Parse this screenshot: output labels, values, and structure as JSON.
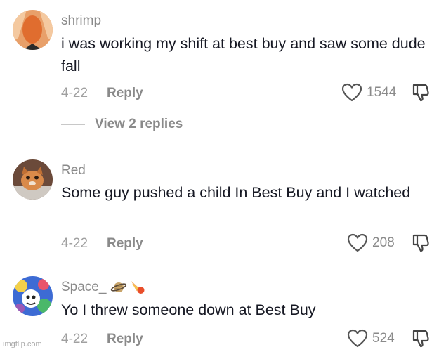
{
  "comments": [
    {
      "username": "shrimp",
      "text": "i was working my shift at best buy and saw some dude fall",
      "date": "4-22",
      "reply_label": "Reply",
      "likes": "1544",
      "view_replies": "View 2 replies"
    },
    {
      "username": "Red",
      "text": "Some guy pushed a child In Best Buy and I watched",
      "date": "4-22",
      "reply_label": "Reply",
      "likes": "208"
    },
    {
      "username": "Space_",
      "text": "Yo I threw someone down at Best Buy",
      "date": "4-22",
      "reply_label": "Reply",
      "likes": "524"
    }
  ],
  "watermark": "imgflip.com",
  "icons": {
    "like": "heart-outline-icon",
    "dislike": "thumbs-down-outline-icon",
    "username_emojis": [
      "saturn-emoji",
      "comet-emoji"
    ]
  }
}
